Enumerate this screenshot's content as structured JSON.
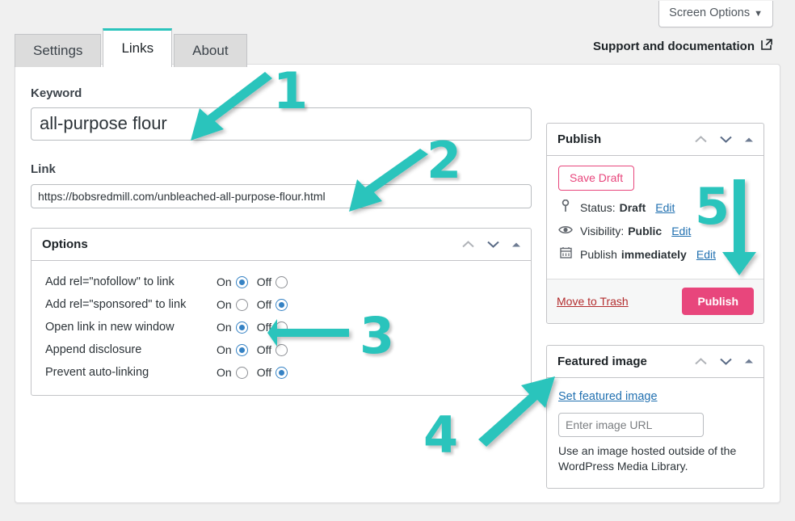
{
  "header": {
    "screen_options_label": "Screen Options",
    "screen_options_caret": "▼",
    "support_link_label": "Support and documentation",
    "external_link_icon": "external-link-icon"
  },
  "tabs": [
    {
      "label": "Settings",
      "active": false
    },
    {
      "label": "Links",
      "active": true
    },
    {
      "label": "About",
      "active": false
    }
  ],
  "form": {
    "keyword_label": "Keyword",
    "keyword_value": "all-purpose flour",
    "link_label": "Link",
    "link_value": "https://bobsredmill.com/unbleached-all-purpose-flour.html"
  },
  "options_box": {
    "title": "Options",
    "on_label": "On",
    "off_label": "Off",
    "rows": [
      {
        "label": "Add rel=\"nofollow\" to link",
        "value": "On"
      },
      {
        "label": "Add rel=\"sponsored\" to link",
        "value": "Off"
      },
      {
        "label": "Open link in new window",
        "value": "On"
      },
      {
        "label": "Append disclosure",
        "value": "On"
      },
      {
        "label": "Prevent auto-linking",
        "value": "Off"
      }
    ]
  },
  "publish_box": {
    "title": "Publish",
    "save_draft_label": "Save Draft",
    "status_prefix": "Status:",
    "status_value": "Draft",
    "visibility_prefix": "Visibility:",
    "visibility_value": "Public",
    "schedule_prefix": "Publish",
    "schedule_value": "immediately",
    "edit_label": "Edit",
    "trash_label": "Move to Trash",
    "publish_label": "Publish",
    "icons": {
      "status": "map-pin-icon",
      "visibility": "eye-icon",
      "schedule": "calendar-icon"
    }
  },
  "featured_box": {
    "title": "Featured image",
    "set_link_label": "Set featured image",
    "url_placeholder": "Enter image URL",
    "url_value": "",
    "help_text": "Use an image hosted outside of the WordPress Media Library."
  },
  "metabox_controls": {
    "move_up_icon": "chevron-up-icon",
    "move_down_icon": "chevron-down-icon",
    "toggle_icon": "triangle-up-icon"
  },
  "annotations": {
    "color": "#2ac4bc",
    "markers": [
      {
        "number": "1",
        "points_to": "keyword-input"
      },
      {
        "number": "2",
        "points_to": "link-input"
      },
      {
        "number": "3",
        "points_to": "open-link-new-window-radios"
      },
      {
        "number": "4",
        "points_to": "set-featured-image-link"
      },
      {
        "number": "5",
        "points_to": "publish-button"
      }
    ]
  },
  "colors": {
    "accent_teal": "#2ac4bc",
    "brand_pink": "#e8467c",
    "link_blue": "#2271b1",
    "radio_blue": "#3582c4",
    "trash_red": "#b32d2e",
    "page_background": "#f0f0f0"
  }
}
